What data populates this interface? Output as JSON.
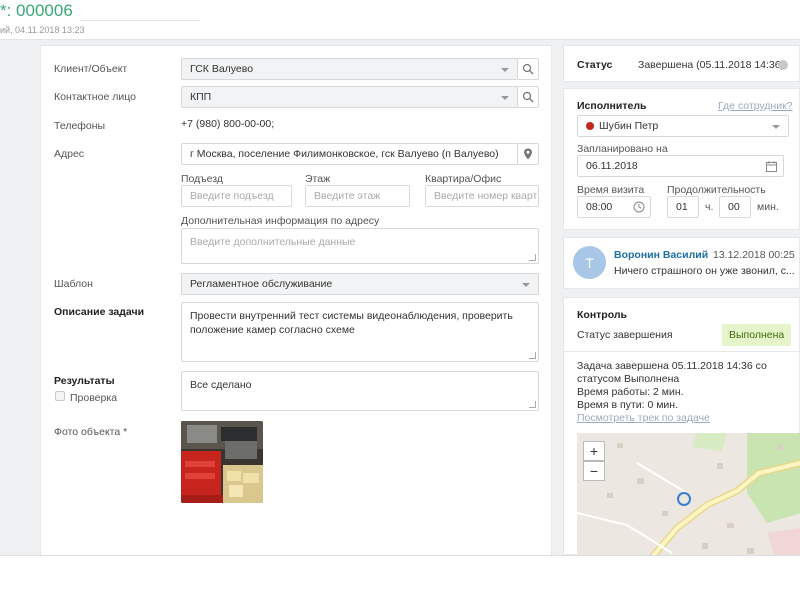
{
  "header": {
    "title": "*: 000006",
    "subtitle": "ий, 04.11.2018 13:23"
  },
  "form": {
    "client_label": "Клиент/Объект",
    "client_value": "ГСК Валуево",
    "contact_label": "Контактное лицо",
    "contact_value": "КПП",
    "phones_label": "Телефоны",
    "phones_value": "+7 (980) 800-00-00;",
    "address_label": "Адрес",
    "address_value": "г Москва, поселение Филимонковское, гск Валуево (п Валуево)",
    "entrance_label": "Подъезд",
    "entrance_placeholder": "Введите подъезд",
    "floor_label": "Этаж",
    "floor_placeholder": "Введите этаж",
    "apartment_label": "Квартира/Офис",
    "apartment_placeholder": "Введите номер кварт",
    "extra_label": "Дополнительная информация по адресу",
    "extra_placeholder": "Введите дополнительные данные",
    "template_label": "Шаблон",
    "template_value": "Регламентное обслуживание",
    "description_label": "Описание задачи",
    "description_value": "Провести внутренний тест системы видеонаблюдения, проверить положение камер согласно схеме",
    "results_label": "Результаты",
    "results_value": "Все сделано",
    "check_label": "Проверка",
    "photo_label": "Фото объекта",
    "photo_required": "*"
  },
  "status_panel": {
    "label": "Статус",
    "value": "Завершена (05.11.2018 14:36)"
  },
  "executor_panel": {
    "label": "Исполнитель",
    "where_link": "Где сотрудник?",
    "executor_value": "Шубин Петр",
    "planned_label": "Запланировано на",
    "planned_value": "06.11.2018",
    "visit_time_label": "Время визита",
    "visit_time_value": "08:00",
    "duration_label": "Продолжительность",
    "duration_hours": "01",
    "hours_unit": "ч.",
    "duration_minutes": "00",
    "minutes_unit": "мин."
  },
  "comment": {
    "avatar_letter": "Т",
    "author": "Воронин Василий",
    "date": "13.12.2018 00:25",
    "text": "Ничего страшного он уже звонил, с..."
  },
  "control": {
    "title": "Контроль",
    "completion_label": "Статус завершения",
    "completion_value": "Выполнена",
    "info_line1": "Задача завершена 05.11.2018 14:36 со",
    "info_line2": "статусом Выполнена",
    "info_line3": "Время работы: 2 мин.",
    "info_line4": "Время в пути: 0 мин.",
    "track_link": "Посмотреть трек по задаче",
    "zoom_in": "+",
    "zoom_out": "−"
  },
  "colors": {
    "accent_green": "#3aa876",
    "status_badge_bg": "#e6f5c9",
    "executor_dot": "#c0271d"
  }
}
